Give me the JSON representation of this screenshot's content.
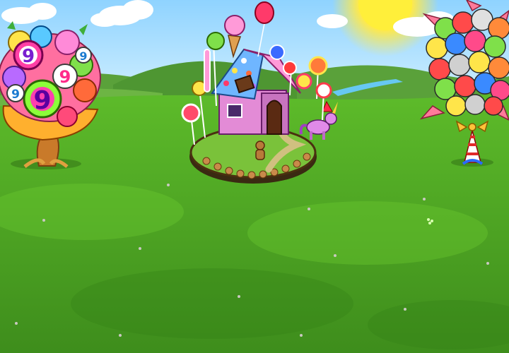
{
  "scene": {
    "type": "farm-game-field",
    "colors": {
      "sky_top": "#8fd3ff",
      "sky_bottom": "#cdeeff",
      "grass_light": "#5fbf2a",
      "grass_dark": "#3f8f1c",
      "river": "#67c8f2",
      "sun": "#ffe94a",
      "gingerbread": "#c98a4a",
      "roof": "#6fb6ff",
      "house_wall": "#e38bd6"
    },
    "objects": [
      {
        "name": "candy-bouquet-tree",
        "icon": "candy-tree-icon",
        "label": "9",
        "label_repeat": 5
      },
      {
        "name": "gingerbread-candy-house",
        "icon": "gingerbread-house-icon"
      },
      {
        "name": "pink-unicorn",
        "icon": "unicorn-icon"
      },
      {
        "name": "gingerbread-man",
        "icon": "gingerbread-man-icon"
      },
      {
        "name": "balloon-bouquet-tree",
        "icon": "balloon-tree-icon"
      }
    ]
  }
}
